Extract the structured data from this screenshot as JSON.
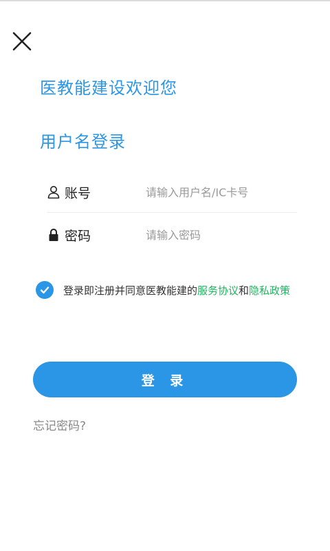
{
  "header": {
    "close_icon": "close-icon"
  },
  "welcome": "医教能建设欢迎您",
  "subtitle": "用户名登录",
  "form": {
    "account": {
      "icon": "user-icon",
      "label": "账号",
      "placeholder": "请输入用户名/IC卡号",
      "value": ""
    },
    "password": {
      "icon": "lock-icon",
      "label": "密码",
      "placeholder": "请输入密码",
      "value": ""
    }
  },
  "agreement": {
    "checked": true,
    "prefix": "登录即注册并同意医教能建的",
    "service_link": "服务协议",
    "conjunction": "和",
    "privacy_link": "隐私政策"
  },
  "login_button": "登 录",
  "forgot_password": "忘记密码?",
  "colors": {
    "primary": "#2c96e6",
    "link": "#1fb45e",
    "text": "#222222",
    "placeholder": "#9a9a9a"
  }
}
